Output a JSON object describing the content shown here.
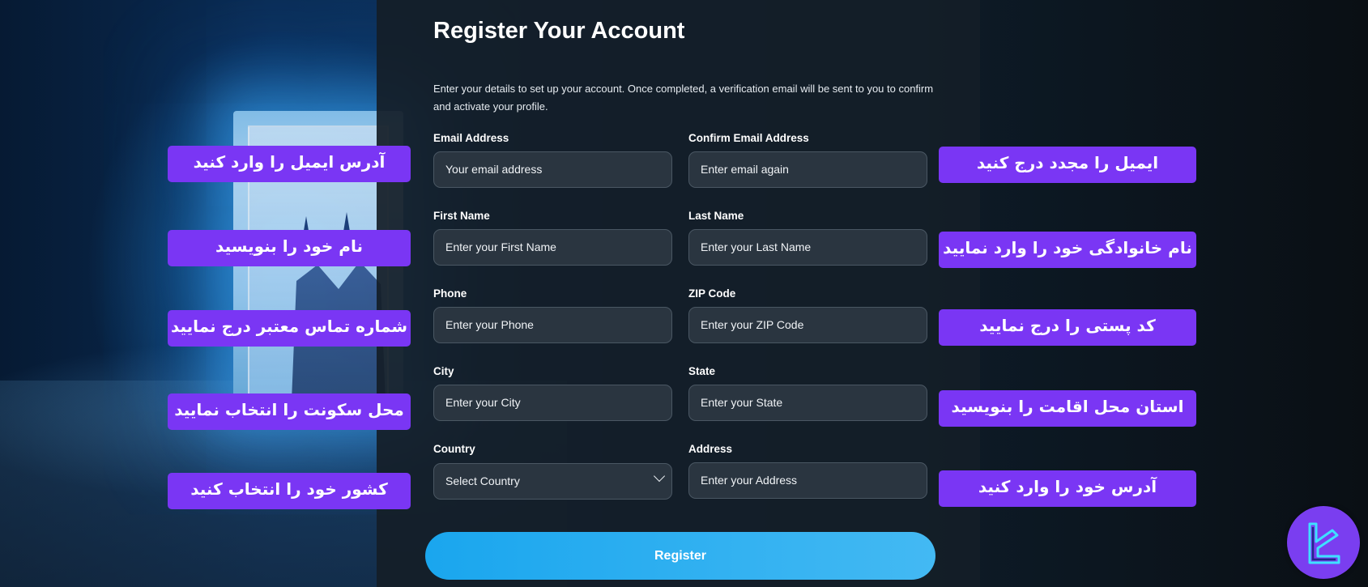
{
  "form": {
    "title": "Register Your Account",
    "description": "Enter your details to set up your account. Once completed, a verification email will be sent to you to confirm and activate your profile.",
    "fields": {
      "email": {
        "label": "Email Address",
        "placeholder": "Your email address"
      },
      "confirm_email": {
        "label": "Confirm Email Address",
        "placeholder": "Enter email again"
      },
      "first_name": {
        "label": "First Name",
        "placeholder": "Enter your First Name"
      },
      "last_name": {
        "label": "Last Name",
        "placeholder": "Enter your Last Name"
      },
      "phone": {
        "label": "Phone",
        "placeholder": "Enter your Phone"
      },
      "zip": {
        "label": "ZIP Code",
        "placeholder": "Enter your ZIP Code"
      },
      "city": {
        "label": "City",
        "placeholder": "Enter your City"
      },
      "state": {
        "label": "State",
        "placeholder": "Enter your State"
      },
      "country": {
        "label": "Country",
        "selected": "Select Country"
      },
      "address": {
        "label": "Address",
        "placeholder": "Enter your Address"
      }
    },
    "register_label": "Register"
  },
  "annotations": {
    "left": [
      "آدرس ایمیل را وارد کنید",
      "نام خود را بنویسید",
      "شماره تماس معتبر درج نمایید",
      "محل سکونت را انتخاب نمایید",
      "کشور خود را انتخاب کنید"
    ],
    "right": [
      "ایمیل را مجدد درج کنید",
      "نام خانوادگی خود را وارد نمایید",
      "کد پستی را درج نمایید",
      "استان محل اقامت را بنویسید",
      "آدرس خود را وارد کنید"
    ]
  },
  "colors": {
    "annotation_bg": "#7a36f4",
    "button": "#2aaef0",
    "panel": "#141e28",
    "logo": "#7a3ef0",
    "logo_mark": "#3ee0ff"
  },
  "logo": {
    "icon": "brand-logo-icon"
  }
}
